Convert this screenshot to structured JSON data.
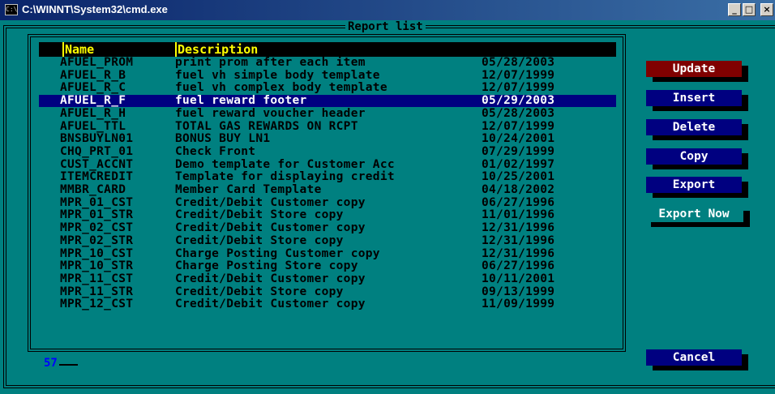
{
  "window": {
    "title": "C:\\WINNT\\System32\\cmd.exe",
    "icon_text": "C:\\",
    "minimize": "_",
    "maximize": "□",
    "close": "×"
  },
  "report": {
    "frame_title": "Report list",
    "columns": {
      "name": "Name",
      "description": "Description"
    },
    "selected_index": 3,
    "rows": [
      {
        "name": "AFUEL_PROM",
        "description": "print prom after each item",
        "date": "05/28/2003"
      },
      {
        "name": "AFUEL_R_B",
        "description": "fuel vh simple body template",
        "date": "12/07/1999"
      },
      {
        "name": "AFUEL_R_C",
        "description": "fuel vh complex body template",
        "date": "12/07/1999"
      },
      {
        "name": "AFUEL_R_F",
        "description": "fuel reward footer",
        "date": "05/29/2003"
      },
      {
        "name": "AFUEL_R_H",
        "description": "fuel reward voucher header",
        "date": "05/28/2003"
      },
      {
        "name": "AFUEL_TTL",
        "description": "TOTAL GAS REWARDS ON RCPT",
        "date": "12/07/1999"
      },
      {
        "name": "BNSBUYLN01",
        "description": "BONUS BUY LN1",
        "date": "10/24/2001"
      },
      {
        "name": "CHQ_PRT_01",
        "description": "Check Front",
        "date": "07/29/1999"
      },
      {
        "name": "CUST_ACCNT",
        "description": "Demo template for Customer Acc",
        "date": "01/02/1997"
      },
      {
        "name": "ITEMCREDIT",
        "description": "Template for displaying credit",
        "date": "10/25/2001"
      },
      {
        "name": "MMBR_CARD",
        "description": "Member Card Template",
        "date": "04/18/2002"
      },
      {
        "name": "MPR_01_CST",
        "description": "Credit/Debit Customer copy",
        "date": "06/27/1996"
      },
      {
        "name": "MPR_01_STR",
        "description": "Credit/Debit Store copy",
        "date": "11/01/1996"
      },
      {
        "name": "MPR_02_CST",
        "description": "Credit/Debit Customer copy",
        "date": "12/31/1996"
      },
      {
        "name": "MPR_02_STR",
        "description": "Credit/Debit Store copy",
        "date": "12/31/1996"
      },
      {
        "name": "MPR_10_CST",
        "description": "Charge Posting Customer copy",
        "date": "12/31/1996"
      },
      {
        "name": "MPR_10_STR",
        "description": "Charge Posting Store copy",
        "date": "06/27/1996"
      },
      {
        "name": "MPR_11_CST",
        "description": "Credit/Debit Customer copy",
        "date": "10/11/2001"
      },
      {
        "name": "MPR_11_STR",
        "description": "Credit/Debit Store copy",
        "date": "09/13/1999"
      },
      {
        "name": "MPR_12_CST",
        "description": "Credit/Debit Customer copy",
        "date": "11/09/1999"
      }
    ],
    "count": "57"
  },
  "buttons": {
    "update": "Update",
    "insert": "Insert",
    "delete": "Delete",
    "copy": "Copy",
    "export": "Export",
    "export_now": "Export Now",
    "cancel": "Cancel"
  },
  "colors": {
    "background": "#008080",
    "header_bg": "#000000",
    "header_text": "#ffff00",
    "selected_bg": "#000080",
    "button_blue": "#000080",
    "button_red": "#800000",
    "count": "#0000ff"
  }
}
